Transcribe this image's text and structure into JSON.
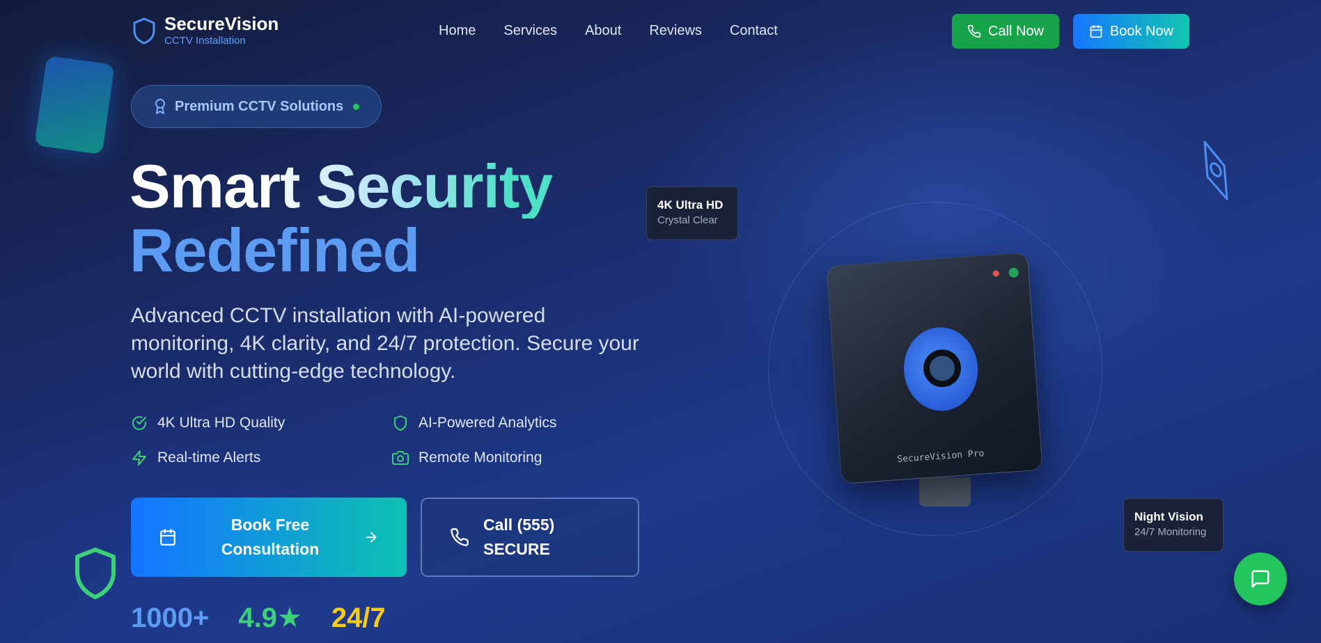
{
  "brand": {
    "name": "SecureVision",
    "tagline": "CCTV Installation",
    "logo_icon": "shield-icon"
  },
  "nav": {
    "links": [
      "Home",
      "Services",
      "About",
      "Reviews",
      "Contact"
    ]
  },
  "header_buttons": {
    "call_label": "Call Now",
    "book_label": "Book Now"
  },
  "badge": {
    "label": "Premium CCTV Solutions"
  },
  "hero": {
    "title_line1": "Smart Security",
    "title_line2": "Redefined",
    "description": "Advanced CCTV installation with AI-powered monitoring, 4K clarity, and 24/7 protection. Secure your world with cutting-edge technology."
  },
  "features": [
    {
      "label": "4K Ultra HD Quality",
      "icon": "check-circle-icon"
    },
    {
      "label": "AI-Powered Analytics",
      "icon": "shield-icon"
    },
    {
      "label": "Real-time Alerts",
      "icon": "lightning-icon"
    },
    {
      "label": "Remote Monitoring",
      "icon": "camera-icon"
    }
  ],
  "cta": {
    "primary_label": "Book Free Consultation",
    "secondary_label": "Call (555) SECURE"
  },
  "stats": [
    {
      "value": "1000+",
      "color": "#5b9bf2"
    },
    {
      "value": "4.9★",
      "color": "#3ecf7a"
    },
    {
      "value": "24/7",
      "color": "#facc15"
    }
  ],
  "device": {
    "label": "SecureVision Pro"
  },
  "cards": [
    {
      "title": "4K Ultra HD",
      "subtitle": "Crystal Clear"
    },
    {
      "title": "Night Vision",
      "subtitle": "24/7 Monitoring"
    }
  ],
  "colors": {
    "accent_blue": "#1677ff",
    "accent_teal": "#10c7b0",
    "call_green": "#16a34a",
    "chat_green": "#22c55e"
  }
}
